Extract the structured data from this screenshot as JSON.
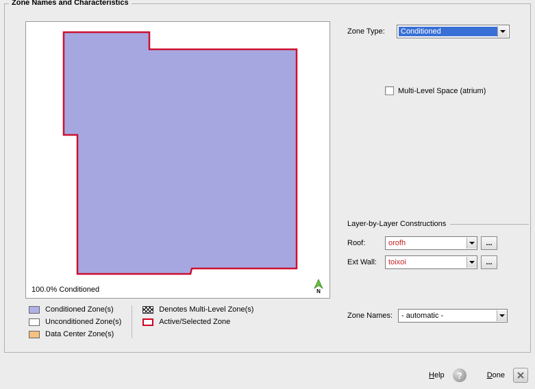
{
  "fieldset_title": "Zone Names and Characteristics",
  "plan": {
    "conditioned_pct": "100.0% Conditioned"
  },
  "legend": {
    "conditioned": "Conditioned Zone(s)",
    "unconditioned": "Unconditioned Zone(s)",
    "datacenter": "Data Center Zone(s)",
    "multilevel": "Denotes Multi-Level Zone(s)",
    "active": "Active/Selected Zone"
  },
  "right": {
    "zone_type_label": "Zone Type:",
    "zone_type_value": "Conditioned",
    "multi_level_label": "Multi-Level Space (atrium)"
  },
  "layer": {
    "title": "Layer-by-Layer Constructions",
    "roof_label": "Roof:",
    "roof_value": "orofh",
    "extwall_label": "Ext Wall:",
    "extwall_value": "toixoi"
  },
  "zone_names": {
    "label": "Zone Names:",
    "value": "- automatic -"
  },
  "footer": {
    "help": "Help",
    "done": "Done"
  }
}
